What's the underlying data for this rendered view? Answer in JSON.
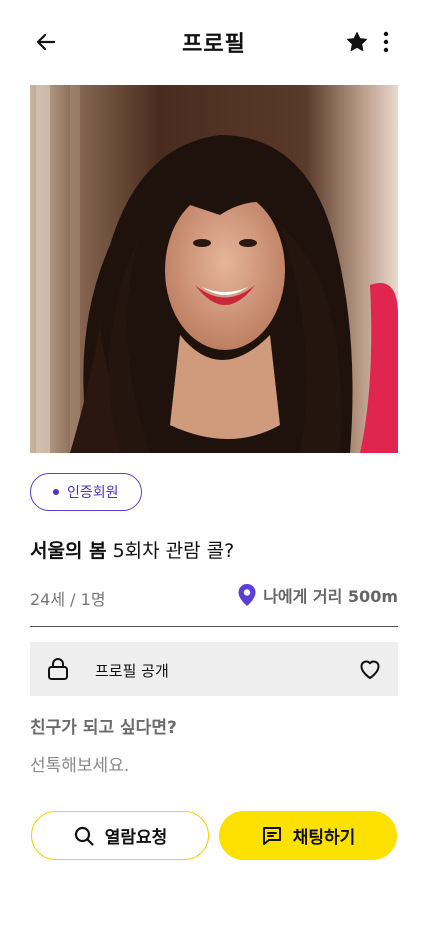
{
  "header": {
    "title": "프로필",
    "back_icon": "arrow-left-icon",
    "favorite_icon": "star-icon",
    "more_icon": "more-vertical-icon"
  },
  "profile": {
    "badge": "인증회원",
    "headline_bold": "서울의 봄",
    "headline_rest": " 5회차 관람 콜?",
    "age_people": "24세 / 1명",
    "distance": "나에게 거리 500m"
  },
  "privacy_bar": {
    "label": "프로필 공개",
    "lock_icon": "lock-icon",
    "heart_icon": "heart-icon"
  },
  "friend_prompt": {
    "question": "친구가 되고 싶다면?",
    "answer": "선톡해보세요."
  },
  "actions": {
    "view_request": "열람요청",
    "chat": "채팅하기"
  },
  "colors": {
    "accent_yellow": "#fbe000",
    "badge_purple": "#4b33c4",
    "location_pin": "#5b3ed6"
  }
}
